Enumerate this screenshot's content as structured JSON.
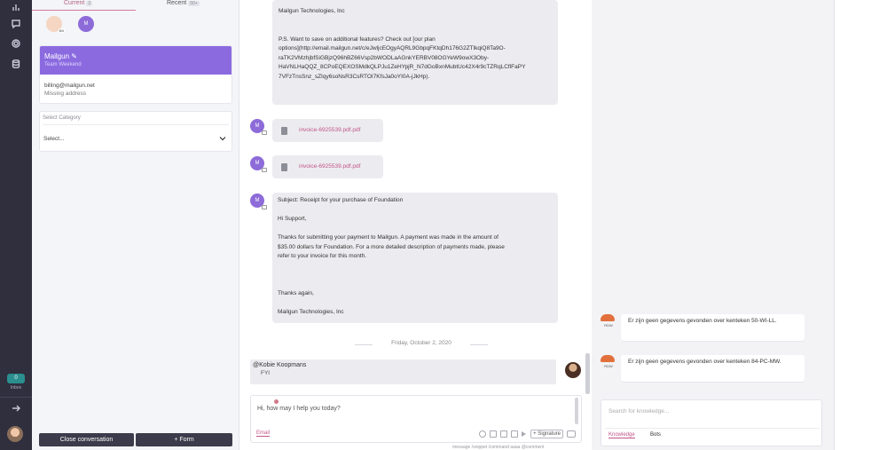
{
  "tabs": {
    "current_label": "Current",
    "current_count": "2",
    "recent_label": "Recent",
    "recent_count": "50+"
  },
  "participants": {
    "avatar1_badge": "BB",
    "avatar2_initial": "M"
  },
  "contact": {
    "name": "Mailgun ✎",
    "team": "Team Weekend",
    "email": "billing@mailgun.net",
    "address": "Missing address"
  },
  "category": {
    "label": "Select Category",
    "value": "Select..."
  },
  "actions": {
    "close": "Close conversation",
    "form": "+ Form"
  },
  "rail": {
    "inbox_count": "0",
    "inbox_label": "Inbox"
  },
  "messages": {
    "first_lines": [
      "Mailgun Technologies, Inc",
      " ",
      " ",
      "P.S. Want to save on additional features? Check out [our plan",
      "options](http://email.mailgun.net/c/eJwljcEOgyAQRL9GbpqFKtqDh176G2ZTlkqiQ8Ta9O-",
      "raTK2VMzhjbfSiGBjzQ96hBZ66Vsp2bWODLaAGnkYERBV08OGYeW9owX3Oby-",
      "HaVNLHaQQZ_8CPoEQEXOSMdkQLPJu1ZeHYpjR_N7dGoBxnMubtUc42X4r9cTZRqLCflFaPY",
      "7VFzTnsSnz_sZIqy6soNsR3CsRTOI7KfsJa0oYI0A-jJkHp)."
    ],
    "avatar_initial": "M",
    "file1": "invoice-6925539.pdf.pdf",
    "file2": "invoice-6925539.pdf.pdf",
    "receipt": {
      "subject": "Subject: Receipt for your purchase of Foundation",
      "greeting": "Hi Support,",
      "body_line1": "Thanks for submitting your payment to Mailgun. A payment was made in the amount of",
      "body_line2": "$35.00 dollars for Foundation. For a more detailed description of payments made, please",
      "body_line3": "refer to your invoice for this month.",
      "thanks": "Thanks again,",
      "signature": "Mailgun Technologies, Inc"
    },
    "date_separator": "Friday, October 2, 2020",
    "note_author": "@Kobie Koopmans",
    "note_text": "FYI"
  },
  "composer": {
    "placeholder": "Hi, how may I help you today?",
    "channel": "Email",
    "signature": "+ Signature",
    "hints": "message  /snippet  /command  aaaa  @comment"
  },
  "side": {
    "bot_label": "RDW",
    "msg1": "Er zijn geen gegevens gevonden over kenteken 50-WI-LL.",
    "msg2": "Er zijn geen gegevens gevonden over kenteken 84-PC-MW.",
    "search_placeholder": "Search for knowledge...",
    "tab_knowledge": "Knowledge",
    "tab_bots": "Bots"
  },
  "colors": {
    "accent": "#8b6ae0",
    "rail": "#2f2f3e",
    "link": "#c2558a"
  },
  "icons": [
    "chart-icon",
    "chat-icon",
    "gear-icon",
    "database-icon",
    "arrow-right-icon",
    "chevron-down-icon",
    "file-icon",
    "smile-icon",
    "attachment-icon",
    "image-icon",
    "video-icon",
    "send-icon"
  ]
}
